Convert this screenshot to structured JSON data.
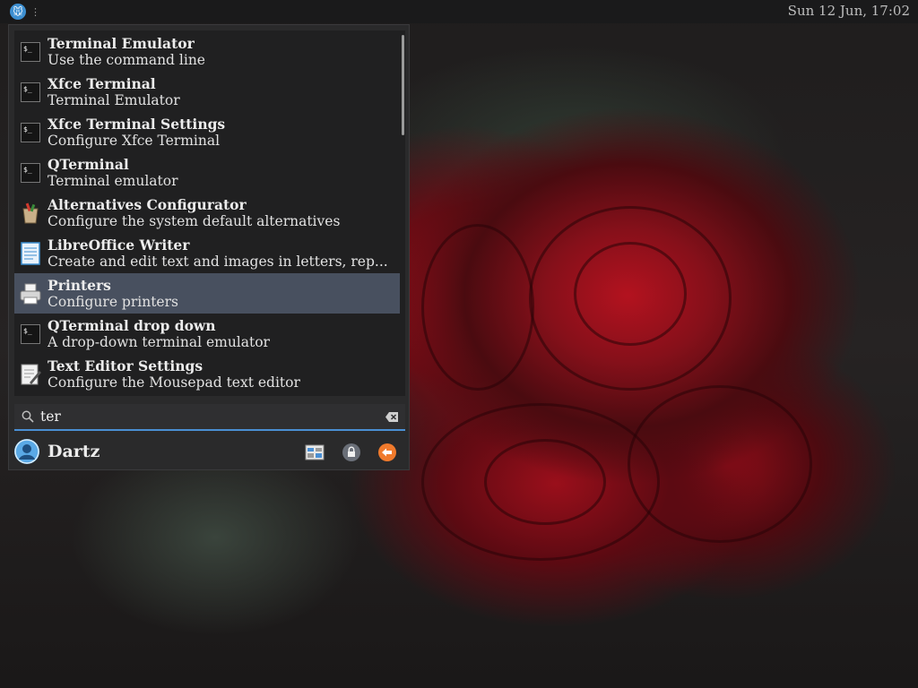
{
  "panel": {
    "clock": "Sun 12 Jun, 17:02"
  },
  "menu": {
    "results": [
      {
        "title": "Terminal Emulator",
        "subtitle": "Use the command line",
        "icon": "terminal-icon",
        "selected": false
      },
      {
        "title": "Xfce Terminal",
        "subtitle": "Terminal Emulator",
        "icon": "terminal-icon",
        "selected": false
      },
      {
        "title": "Xfce Terminal Settings",
        "subtitle": "Configure Xfce Terminal",
        "icon": "terminal-icon",
        "selected": false
      },
      {
        "title": "QTerminal",
        "subtitle": "Terminal emulator",
        "icon": "terminal-icon",
        "selected": false
      },
      {
        "title": "Alternatives Configurator",
        "subtitle": "Configure the system default alternatives",
        "icon": "alternatives-icon",
        "selected": false
      },
      {
        "title": "LibreOffice Writer",
        "subtitle": "Create and edit text and images in letters, rep...",
        "icon": "writer-document-icon",
        "selected": false
      },
      {
        "title": "Printers",
        "subtitle": "Configure printers",
        "icon": "printer-icon",
        "selected": true
      },
      {
        "title": "QTerminal drop down",
        "subtitle": "A drop-down terminal emulator",
        "icon": "terminal-icon",
        "selected": false
      },
      {
        "title": "Text Editor Settings",
        "subtitle": "Configure the Mousepad text editor",
        "icon": "text-editor-icon",
        "selected": false
      }
    ],
    "search": {
      "value": "ter"
    },
    "user": {
      "name": "Dartz"
    }
  },
  "colors": {
    "selection": "#48505f",
    "search_underline": "#4a8fd4",
    "logout_orange": "#f07a2c"
  }
}
